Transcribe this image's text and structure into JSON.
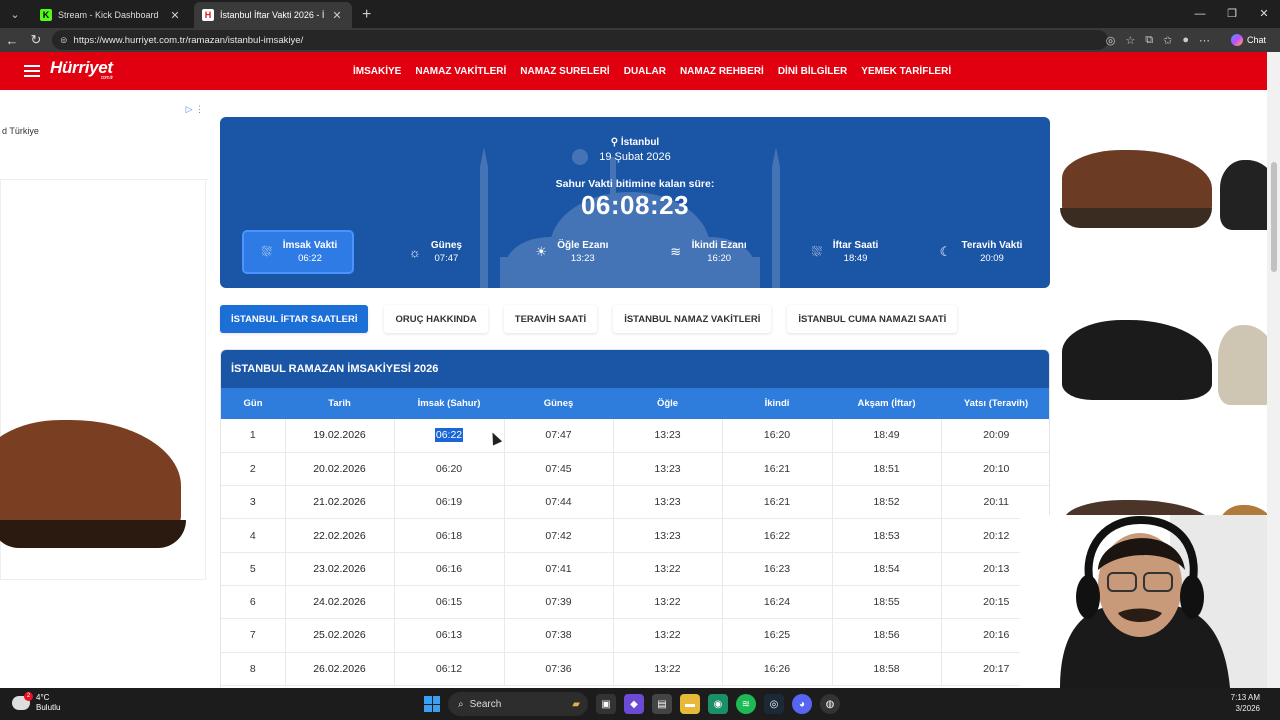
{
  "browser": {
    "tabs": [
      {
        "title": "Stream - Kick Dashboard",
        "icon": "K"
      },
      {
        "title": "İstanbul İftar Vakti 2026 - İstanbul",
        "icon": "H"
      }
    ],
    "url": "https://www.hurriyet.com.tr/ramazan/istanbul-imsakiye/",
    "chat_label": "Chat"
  },
  "site": {
    "logo": "Hürriyet",
    "logo_sub": "com.tr",
    "nav": [
      "İMSAKİYE",
      "NAMAZ VAKİTLERİ",
      "NAMAZ SURELERİ",
      "DUALAR",
      "NAMAZ REHBERİ",
      "DİNİ BİLGİLER",
      "YEMEK TARİFLERİ"
    ]
  },
  "ad": {
    "label": "d Türkiye"
  },
  "hero": {
    "city": "İstanbul",
    "date": "19 Şubat 2026",
    "countdown_label": "Sahur Vakti bitimine kalan süre:",
    "countdown": "06:08:23",
    "times": [
      {
        "name": "İmsak Vakti",
        "time": "06:22",
        "icon": "sunrise-icon"
      },
      {
        "name": "Güneş",
        "time": "07:47",
        "icon": "sun-outline-icon"
      },
      {
        "name": "Öğle Ezanı",
        "time": "13:23",
        "icon": "sun-icon"
      },
      {
        "name": "İkindi Ezanı",
        "time": "16:20",
        "icon": "sunset-icon"
      },
      {
        "name": "İftar Saati",
        "time": "18:49",
        "icon": "sunrise-icon"
      },
      {
        "name": "Teravih Vakti",
        "time": "20:09",
        "icon": "moon-icon"
      }
    ]
  },
  "pills": [
    "İSTANBUL İFTAR SAATLERİ",
    "ORUÇ HAKKINDA",
    "TERAVİH SAATİ",
    "İSTANBUL NAMAZ VAKİTLERİ",
    "İSTANBUL CUMA NAMAZI SAATİ"
  ],
  "table": {
    "title": "İSTANBUL RAMAZAN İMSAKİYESİ 2026",
    "headers": [
      "Gün",
      "Tarih",
      "İmsak (Sahur)",
      "Güneş",
      "Öğle",
      "İkindi",
      "Akşam (İftar)",
      "Yatsı (Teravih)"
    ],
    "rows": [
      [
        "1",
        "19.02.2026",
        "06:22",
        "07:47",
        "13:23",
        "16:20",
        "18:49",
        "20:09"
      ],
      [
        "2",
        "20.02.2026",
        "06:20",
        "07:45",
        "13:23",
        "16:21",
        "18:51",
        "20:10"
      ],
      [
        "3",
        "21.02.2026",
        "06:19",
        "07:44",
        "13:23",
        "16:21",
        "18:52",
        "20:11"
      ],
      [
        "4",
        "22.02.2026",
        "06:18",
        "07:42",
        "13:23",
        "16:22",
        "18:53",
        "20:12"
      ],
      [
        "5",
        "23.02.2026",
        "06:16",
        "07:41",
        "13:22",
        "16:23",
        "18:54",
        "20:13"
      ],
      [
        "6",
        "24.02.2026",
        "06:15",
        "07:39",
        "13:22",
        "16:24",
        "18:55",
        "20:15"
      ],
      [
        "7",
        "25.02.2026",
        "06:13",
        "07:38",
        "13:22",
        "16:25",
        "18:56",
        "20:16"
      ],
      [
        "8",
        "26.02.2026",
        "06:12",
        "07:36",
        "13:22",
        "16:26",
        "18:58",
        "20:17"
      ]
    ]
  },
  "taskbar": {
    "temp": "4°C",
    "weather": "Bulutlu",
    "weather_badge": "2",
    "search": "Search",
    "time": "7:13 AM",
    "date": "3/2026"
  }
}
